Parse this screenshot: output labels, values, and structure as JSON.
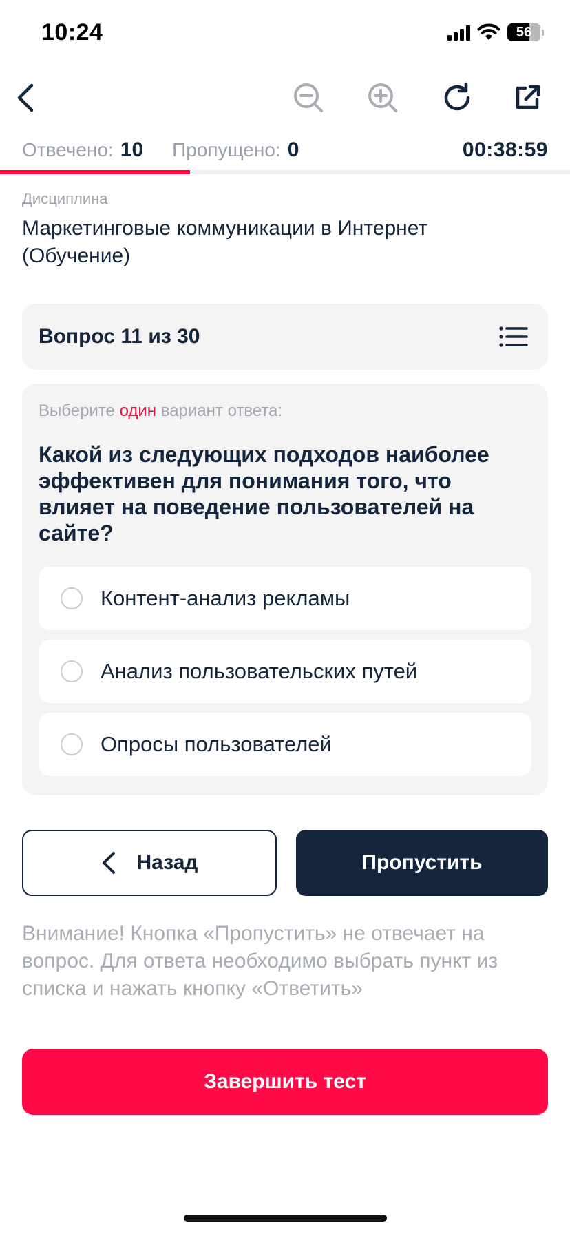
{
  "status_bar": {
    "time": "10:24",
    "battery": "56",
    "icons": [
      "signal-icon",
      "wifi-icon",
      "battery-icon"
    ]
  },
  "toolbar": {
    "icons": [
      "back-chevron-icon",
      "zoom-out-icon",
      "zoom-in-icon",
      "refresh-icon",
      "external-link-icon"
    ]
  },
  "progress": {
    "answered_label": "Отвечено:",
    "answered_value": "10",
    "skipped_label": "Пропущено:",
    "skipped_value": "0",
    "timer": "00:38:59",
    "fraction_complete": 0.333,
    "bar_color": "#ff0a47"
  },
  "discipline": {
    "label": "Дисциплина",
    "title": "Маркетинговые коммуникации в Интернет (Обучение)"
  },
  "question_header": {
    "title": "Вопрос 11 из 30",
    "icon": "list-icon"
  },
  "question": {
    "hint_prefix": "Выберите ",
    "hint_accent": "один",
    "hint_suffix": " вариант ответа:",
    "text": "Какой из следующих подходов наиболее эффективен для понимания того, что влияет на поведение пользователей на сайте?",
    "options": [
      {
        "label": "Контент-анализ рекламы",
        "selected": false
      },
      {
        "label": "Анализ пользовательских путей",
        "selected": false
      },
      {
        "label": "Опросы пользователей",
        "selected": false
      }
    ]
  },
  "nav": {
    "back_label": "Назад",
    "skip_label": "Пропустить"
  },
  "notice": "Внимание! Кнопка «Пропустить» не отвечает на вопрос. Для ответа необходимо выбрать пункт из списка и нажать кнопку «Ответить»",
  "finish_label": "Завершить тест",
  "colors": {
    "primary": "#15253b",
    "accent": "#ff0a47",
    "card_bg": "#f4f4f5",
    "muted": "#9aa1aa"
  }
}
